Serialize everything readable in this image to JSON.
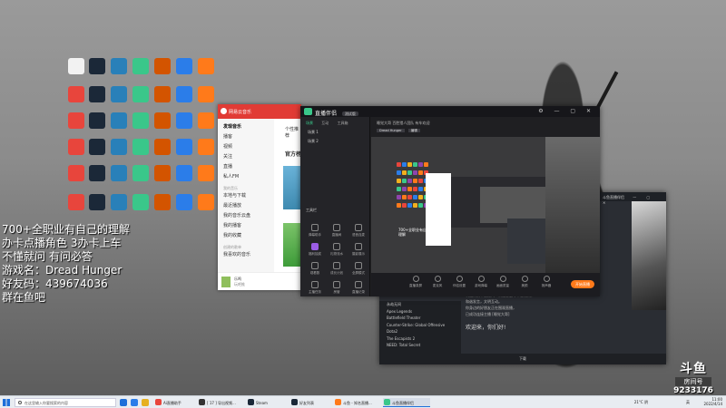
{
  "overlay": {
    "lines": [
      "700+全职业有自己的理解",
      "办卡点播角色   3办卡上车",
      "不懂就问 有问必答",
      "游戏名：Dread Hunger",
      "好友码：439674036",
      "群在鱼吧"
    ]
  },
  "music_window": {
    "title": "网易云音乐",
    "nav": [
      "发现音乐",
      "播客",
      "视频",
      "关注",
      "直播",
      "私人FM"
    ],
    "my_music_label": "我的音乐",
    "my_items": [
      "本地与下载",
      "最近播放",
      "我的音乐云盘",
      "我的播客",
      "我的收藏"
    ],
    "created_label": "创建的歌单",
    "playlist": "我喜欢的音乐",
    "main_tab": "个性推荐",
    "main_section": "官方榜",
    "player_title": "乐鸣",
    "player_sub": "玩吧推"
  },
  "companion": {
    "title": "直播伴侣",
    "version": "测试版",
    "tabs": [
      "场景",
      "互动",
      "工具箱"
    ],
    "scenes": [
      "场景 1",
      "场景 2"
    ],
    "tools_header": "工具栏",
    "tools": [
      "弹幕助手",
      "直播间",
      "语音连麦",
      "福利抽奖",
      "礼物流水",
      "摄影展示",
      "观看数",
      "成长计划",
      "全屏模式",
      "主播任务",
      "房管",
      "直播记录"
    ],
    "room_info": "睡觉大哥   百胜猎人团队 有车欢迎",
    "chips": [
      "Dread Hunger",
      "编辑"
    ],
    "bottom_items": [
      "直播录屏",
      "麦克风",
      "伴侣设置",
      "游戏弹幕",
      "画面质量",
      "美颜",
      "扬声器"
    ],
    "start_label": "开始直播"
  },
  "chat": {
    "title": "斗鱼直播伴侣",
    "games": [
      "永劫无间",
      "Apex Legends",
      "Battlefield Theater",
      "Counter-Strike: Global Offensive",
      "Dota2",
      "The Escapists 2",
      "NEED: Total Secret"
    ],
    "lines": [
      "欢迎来到本直播间！请注意遵守平台规则，",
      "和谐发言，文明互动。",
      "你身边的好朋友正在围观直播，",
      "已成功连接主播 [睡觉大哥]"
    ],
    "big_line": "欢迎来，你们好!",
    "bottom": "下载"
  },
  "douyu": {
    "logo": "斗鱼",
    "sub": "房间号",
    "room": "9233176"
  },
  "taskbar": {
    "search_placeholder": "在这里输入你要搜索的内容",
    "apps": [
      "Ai直播助手",
      "[ 17 ] 导出视频...",
      "Steam",
      "好友列表",
      "斗鱼 - 知名直播...",
      "斗鱼直播伴侣"
    ],
    "weather": "21°C 阴",
    "lang": "英",
    "time": "11:00",
    "date": "2022/4/14"
  },
  "colors": {
    "accent": "#3ac78a",
    "music_red": "#e13b35",
    "start_orange": "#ff7a1a"
  }
}
